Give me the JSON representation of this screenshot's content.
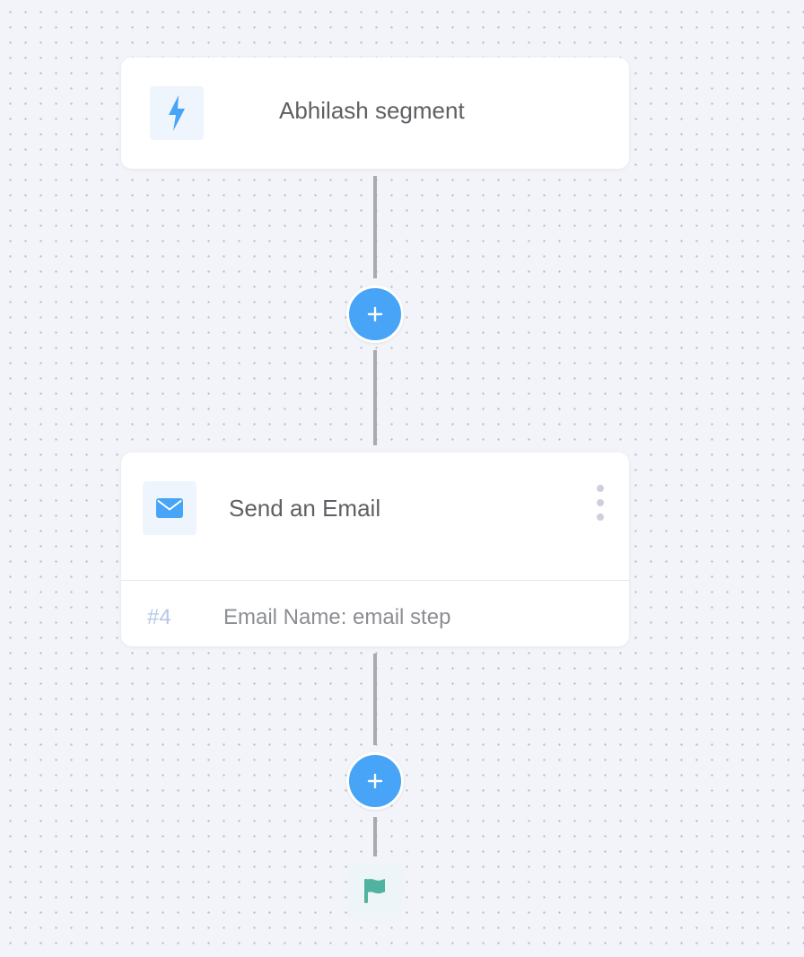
{
  "trigger_node": {
    "icon": "lightning-bolt-icon",
    "title": "Abhilash segment"
  },
  "email_node": {
    "icon": "envelope-icon",
    "title": "Send an Email",
    "step_id": "#4",
    "detail": "Email Name: email step"
  },
  "add_step_buttons": [
    {
      "icon": "plus-icon"
    },
    {
      "icon": "plus-icon"
    }
  ],
  "end_node": {
    "icon": "flag-icon"
  },
  "colors": {
    "canvas_background": "#f2f4f9",
    "accent_blue": "#47a4f7",
    "connector_gray": "#a9aaae",
    "flag_green": "#52b2a0",
    "step_id_blue": "#b6c8e6"
  }
}
